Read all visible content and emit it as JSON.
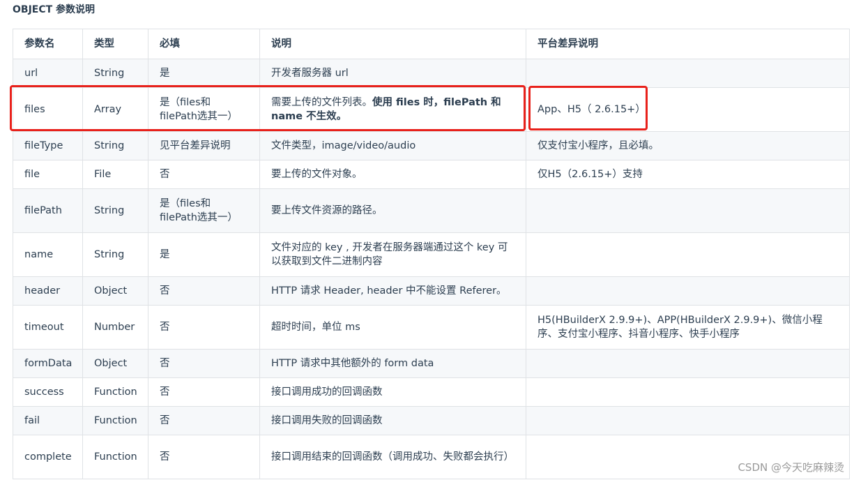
{
  "heading": "OBJECT 参数说明",
  "columns": [
    "参数名",
    "类型",
    "必填",
    "说明",
    "平台差异说明"
  ],
  "rows": [
    {
      "name": "url",
      "type": "String",
      "required": "是",
      "desc": "开发者服务器 url",
      "platform": ""
    },
    {
      "name": "files",
      "type": "Array",
      "required": "是（files和filePath选其一）",
      "desc_plain": "需要上传的文件列表。",
      "desc_bold": "使用 files 时，filePath 和 name 不生效。",
      "platform": "App、H5（ 2.6.15+）"
    },
    {
      "name": "fileType",
      "type": "String",
      "required": "见平台差异说明",
      "desc": "文件类型，image/video/audio",
      "platform": "仅支付宝小程序，且必填。"
    },
    {
      "name": "file",
      "type": "File",
      "required": "否",
      "desc": "要上传的文件对象。",
      "platform": "仅H5（2.6.15+）支持"
    },
    {
      "name": "filePath",
      "type": "String",
      "required": "是（files和filePath选其一）",
      "desc": "要上传文件资源的路径。",
      "platform": ""
    },
    {
      "name": "name",
      "type": "String",
      "required": "是",
      "desc": "文件对应的 key , 开发者在服务器端通过这个 key 可以获取到文件二进制内容",
      "platform": ""
    },
    {
      "name": "header",
      "type": "Object",
      "required": "否",
      "desc": "HTTP 请求 Header, header 中不能设置 Referer。",
      "platform": ""
    },
    {
      "name": "timeout",
      "type": "Number",
      "required": "否",
      "desc": "超时时间，单位 ms",
      "platform": "H5(HBuilderX 2.9.9+)、APP(HBuilderX 2.9.9+)、微信小程序、支付宝小程序、抖音小程序、快手小程序"
    },
    {
      "name": "formData",
      "type": "Object",
      "required": "否",
      "desc": "HTTP 请求中其他额外的 form data",
      "platform": ""
    },
    {
      "name": "success",
      "type": "Function",
      "required": "否",
      "desc": "接口调用成功的回调函数",
      "platform": ""
    },
    {
      "name": "fail",
      "type": "Function",
      "required": "否",
      "desc": "接口调用失败的回调函数",
      "platform": ""
    },
    {
      "name": "complete",
      "type": "Function",
      "required": "否",
      "desc": "接口调用结束的回调函数（调用成功、失败都会执行）",
      "platform": ""
    }
  ],
  "watermark": "CSDN @今天吃麻辣烫"
}
